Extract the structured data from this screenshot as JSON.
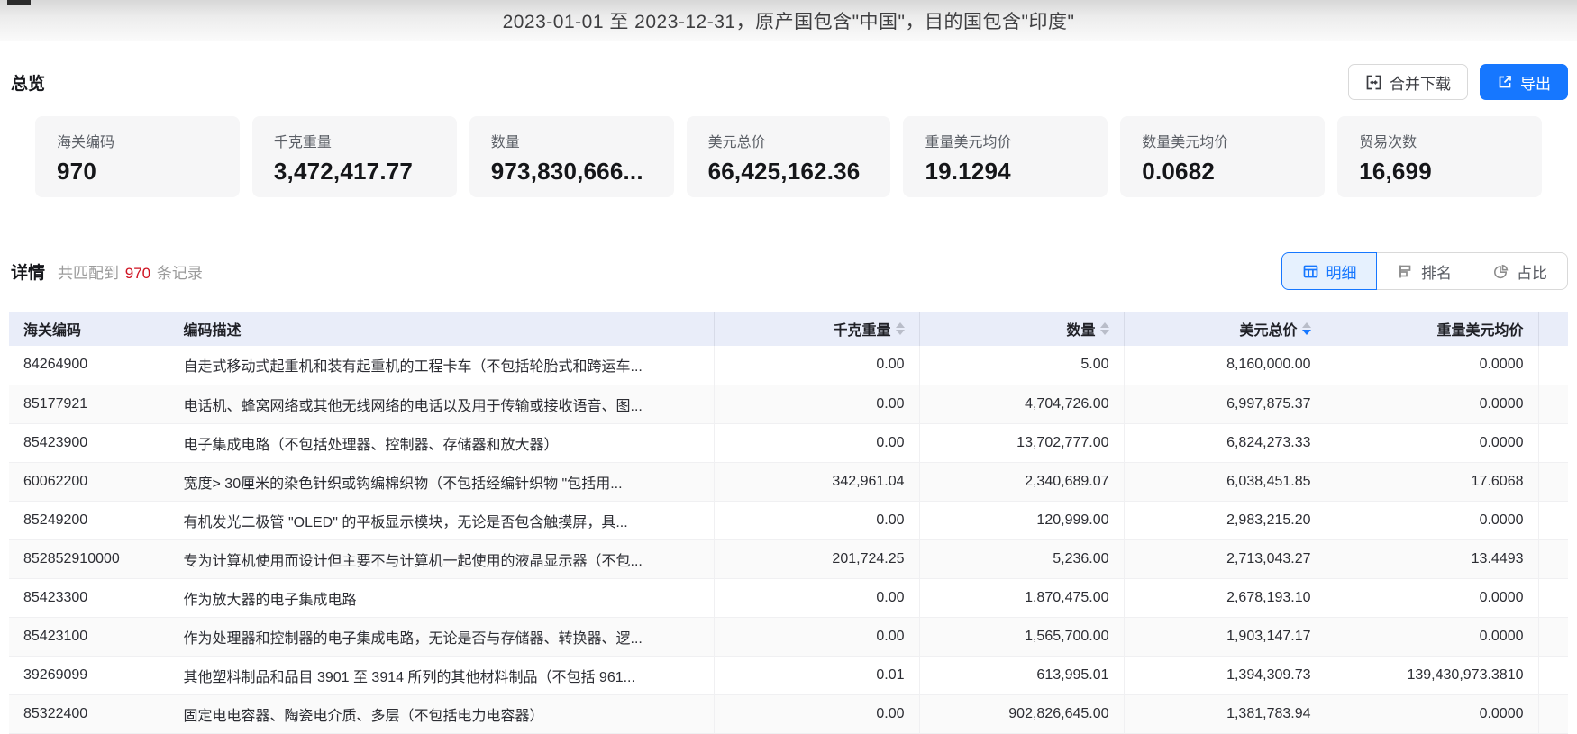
{
  "title_bar": {
    "text": "2023-01-01 至 2023-12-31，原产国包含\"中国\"，目的国包含\"印度\""
  },
  "overview": {
    "heading": "总览",
    "merge_download_label": "合并下载",
    "export_label": "导出",
    "stats": [
      {
        "label": "海关编码",
        "value": "970"
      },
      {
        "label": "千克重量",
        "value": "3,472,417.77"
      },
      {
        "label": "数量",
        "value": "973,830,666..."
      },
      {
        "label": "美元总价",
        "value": "66,425,162.36"
      },
      {
        "label": "重量美元均价",
        "value": "19.1294"
      },
      {
        "label": "数量美元均价",
        "value": "0.0682"
      },
      {
        "label": "贸易次数",
        "value": "16,699"
      }
    ]
  },
  "detail": {
    "heading": "详情",
    "match_prefix": "共匹配到",
    "match_count": "970",
    "match_suffix": "条记录",
    "tabs": [
      {
        "label": "明细",
        "icon": "table-icon",
        "active": true
      },
      {
        "label": "排名",
        "icon": "ranking-icon",
        "active": false
      },
      {
        "label": "占比",
        "icon": "pie-chart-icon",
        "active": false
      }
    ]
  },
  "table": {
    "columns": [
      {
        "label": "海关编码",
        "align": "left",
        "sortable": false,
        "sort": null
      },
      {
        "label": "编码描述",
        "align": "left",
        "sortable": false,
        "sort": null
      },
      {
        "label": "千克重量",
        "align": "right",
        "sortable": true,
        "sort": "none"
      },
      {
        "label": "数量",
        "align": "right",
        "sortable": true,
        "sort": "none"
      },
      {
        "label": "美元总价",
        "align": "right",
        "sortable": true,
        "sort": "desc"
      },
      {
        "label": "重量美元均价",
        "align": "right",
        "sortable": false,
        "sort": null
      }
    ],
    "rows": [
      {
        "cells": [
          "84264900",
          "自走式移动式起重机和装有起重机的工程卡车（不包括轮胎式和跨运车...",
          "0.00",
          "5.00",
          "8,160,000.00",
          "0.0000"
        ]
      },
      {
        "cells": [
          "85177921",
          "电话机、蜂窝网络或其他无线网络的电话以及用于传输或接收语音、图...",
          "0.00",
          "4,704,726.00",
          "6,997,875.37",
          "0.0000"
        ]
      },
      {
        "cells": [
          "85423900",
          "电子集成电路（不包括处理器、控制器、存储器和放大器）",
          "0.00",
          "13,702,777.00",
          "6,824,273.33",
          "0.0000"
        ]
      },
      {
        "cells": [
          "60062200",
          "宽度> 30厘米的染色针织或钩编棉织物（不包括经编针织物 \"包括用...",
          "342,961.04",
          "2,340,689.07",
          "6,038,451.85",
          "17.6068"
        ]
      },
      {
        "cells": [
          "85249200",
          "有机发光二极管 \"OLED\" 的平板显示模块，无论是否包含触摸屏，具...",
          "0.00",
          "120,999.00",
          "2,983,215.20",
          "0.0000"
        ]
      },
      {
        "cells": [
          "852852910000",
          "专为计算机使用而设计但主要不与计算机一起使用的液晶显示器（不包...",
          "201,724.25",
          "5,236.00",
          "2,713,043.27",
          "13.4493"
        ]
      },
      {
        "cells": [
          "85423300",
          "作为放大器的电子集成电路",
          "0.00",
          "1,870,475.00",
          "2,678,193.10",
          "0.0000"
        ]
      },
      {
        "cells": [
          "85423100",
          "作为处理器和控制器的电子集成电路，无论是否与存储器、转换器、逻...",
          "0.00",
          "1,565,700.00",
          "1,903,147.17",
          "0.0000"
        ]
      },
      {
        "cells": [
          "39269099",
          "其他塑料制品和品目 3901 至 3914 所列的其他材料制品（不包括 961...",
          "0.01",
          "613,995.01",
          "1,394,309.73",
          "139,430,973.3810"
        ]
      },
      {
        "cells": [
          "85322400",
          "固定电电容器、陶瓷电介质、多层（不包括电力电容器）",
          "0.00",
          "902,826,645.00",
          "1,381,783.94",
          "0.0000"
        ]
      }
    ]
  },
  "colors": {
    "accent_blue": "#1677ff",
    "active_tab_bg": "#e6f1fe",
    "count_red": "#cf1322",
    "table_header_bg": "#e9edf9"
  }
}
